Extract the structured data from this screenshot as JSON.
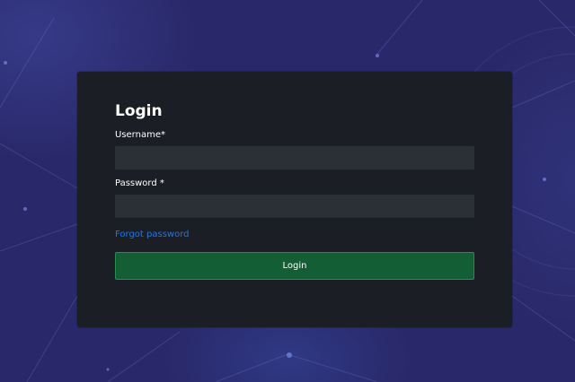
{
  "login": {
    "title": "Login",
    "username_label": "Username*",
    "username_value": "",
    "password_label": "Password *",
    "password_value": "",
    "forgot_password_link": "Forgot password",
    "login_button": "Login"
  },
  "colors": {
    "background": "#29286a",
    "card": "#1b1e24",
    "input": "#2b3036",
    "link": "#1a78f0",
    "button": "#135e35",
    "button_border": "#2c8a55"
  }
}
